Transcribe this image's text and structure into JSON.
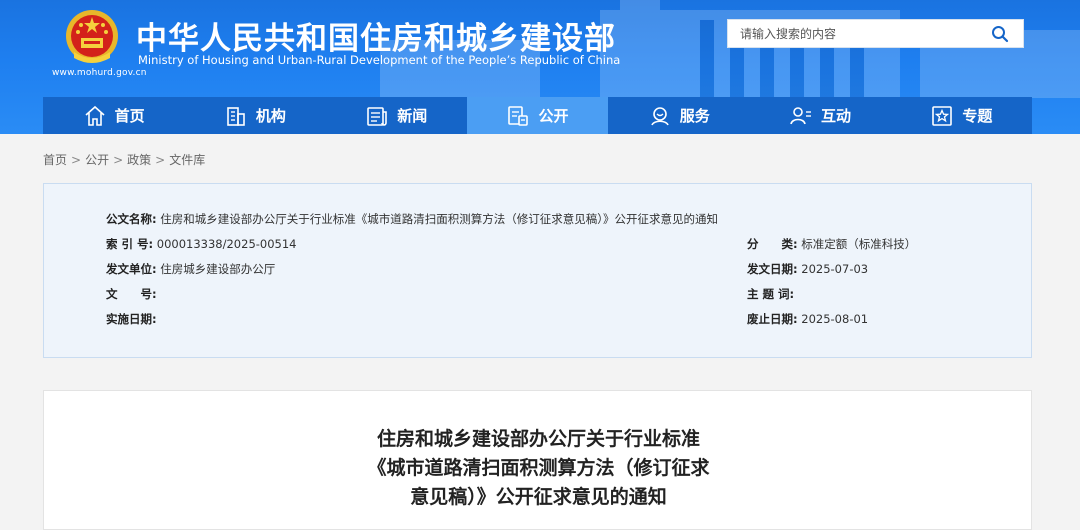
{
  "header": {
    "title": "中华人民共和国住房和城乡建设部",
    "subtitle": "Ministry of Housing and Urban-Rural Development of the People’s Republic of China",
    "url": "www.mohurd.gov.cn",
    "brand_color": "#1e7ff0"
  },
  "search": {
    "placeholder": "请输入搜索的内容",
    "icon": "search-icon"
  },
  "nav": {
    "items": [
      {
        "label": "首页",
        "icon": "home-icon"
      },
      {
        "label": "机构",
        "icon": "building-icon"
      },
      {
        "label": "新闻",
        "icon": "news-icon"
      },
      {
        "label": "公开",
        "icon": "document-icon",
        "active": true
      },
      {
        "label": "服务",
        "icon": "service-icon"
      },
      {
        "label": "互动",
        "icon": "interaction-icon"
      },
      {
        "label": "专题",
        "icon": "topic-icon"
      }
    ]
  },
  "breadcrumb": [
    "首页",
    "公开",
    "政策",
    "文件库"
  ],
  "meta": {
    "doc_name_key": "公文名称:",
    "doc_name": "住房和城乡建设部办公厅关于行业标准《城市道路清扫面积测算方法（修订征求意见稿）》公开征求意见的通知",
    "index_key": "索 引 号:",
    "index": "000013338/2025-00514",
    "category_key": "分　　类:",
    "category": "标准定额（标准科技）",
    "issuer_key": "发文单位:",
    "issuer": "住房城乡建设部办公厅",
    "issue_date_key": "发文日期:",
    "issue_date": "2025-07-03",
    "doc_no_key": "文　　号:",
    "doc_no": "",
    "keywords_key": "主 题 词:",
    "keywords": "",
    "effective_key": "实施日期:",
    "effective": "",
    "expire_key": "废止日期:",
    "expire": "2025-08-01"
  },
  "article": {
    "title_line1": "住房和城乡建设部办公厅关于行业标准",
    "title_line2": "《城市道路清扫面积测算方法（修订征求",
    "title_line3": "意见稿）》公开征求意见的通知"
  }
}
